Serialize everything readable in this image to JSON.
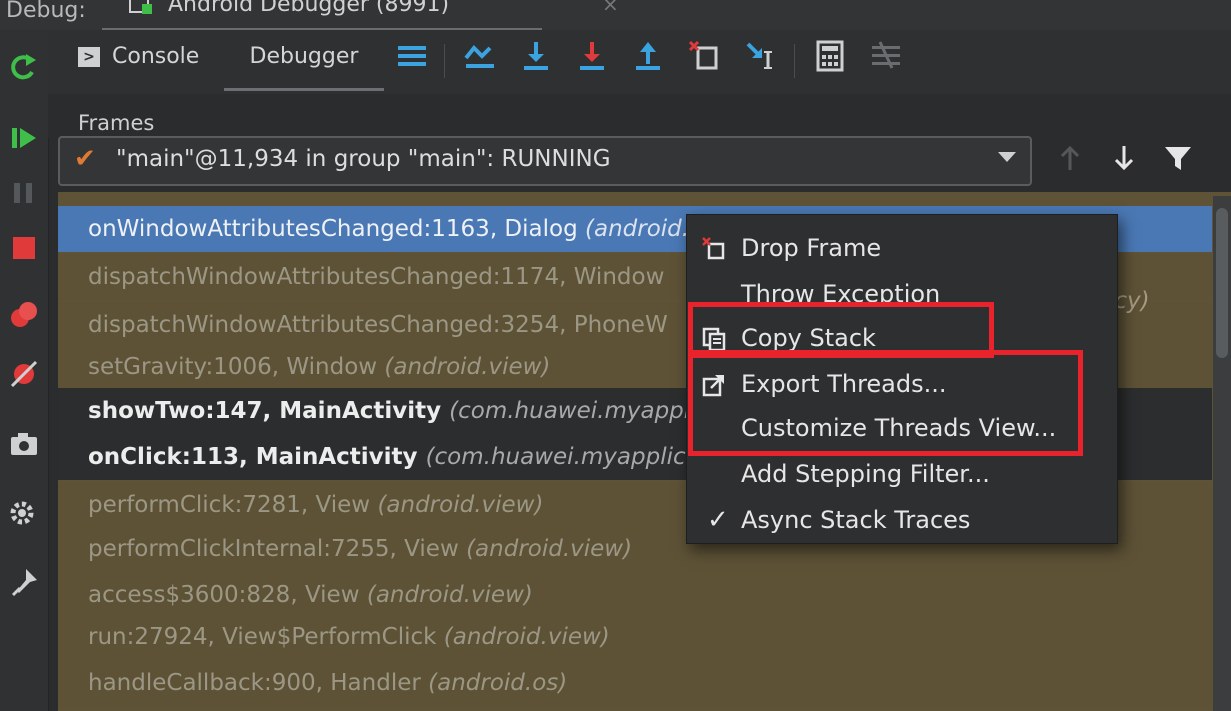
{
  "debug_bar": {
    "label": "Debug:",
    "session_title": "Android Debugger (8991)",
    "close_glyph": "×"
  },
  "tabs": {
    "console": "Console",
    "debugger": "Debugger"
  },
  "frames": {
    "title": "Frames",
    "thread": "\"main\"@11,934 in group \"main\": RUNNING"
  },
  "frame_rows": [
    {
      "method": "onWindowAttributesChanged:1163, Dialog",
      "package": "(android.app)"
    },
    {
      "method": "dispatchWindowAttributesChanged:1174, Window",
      "package": ""
    },
    {
      "method": "dispatchWindowAttributesChanged:3254, PhoneW",
      "package": ""
    },
    {
      "method": "setGravity:1006, Window",
      "package": "(android.view)"
    },
    {
      "method": "showTwo:147, MainActivity",
      "package": "(com.huawei.myapplic"
    },
    {
      "method": "onClick:113, MainActivity",
      "package": "(com.huawei.myapplica"
    },
    {
      "method": "performClick:7281, View",
      "package": "(android.view)"
    },
    {
      "method": "performClickInternal:7255, View",
      "package": "(android.view)"
    },
    {
      "method": "access$3600:828, View",
      "package": "(android.view)"
    },
    {
      "method": "run:27924, View$PerformClick",
      "package": "(android.view)"
    },
    {
      "method": "handleCallback:900, Handler",
      "package": "(android.os)"
    }
  ],
  "offscreen_hint": "icy)",
  "context_menu": {
    "drop_frame": "Drop Frame",
    "throw_exception": "Throw Exception",
    "copy_stack": "Copy Stack",
    "export_threads": "Export Threads...",
    "customize_threads_view": "Customize Threads View...",
    "add_stepping_filter": "Add Stepping Filter...",
    "async_stack_traces": "Async Stack Traces",
    "check_glyph": "✓"
  },
  "colors": {
    "selection": "#4a78b4",
    "library_frame_bg": "#5e5336",
    "highlight_box": "#e8232b",
    "resume_green": "#3fbf4a",
    "stop_red": "#e03a3a",
    "step_blue": "#3aa3e0"
  },
  "icons": {
    "rerun": "rerun-icon",
    "resume": "resume-icon",
    "pause": "pause-icon",
    "stop": "stop-icon",
    "breakpoints": "view-breakpoints-icon",
    "mute": "mute-breakpoints-icon",
    "camera": "get-thread-dump-icon",
    "settings": "settings-icon",
    "pin": "pin-icon"
  }
}
